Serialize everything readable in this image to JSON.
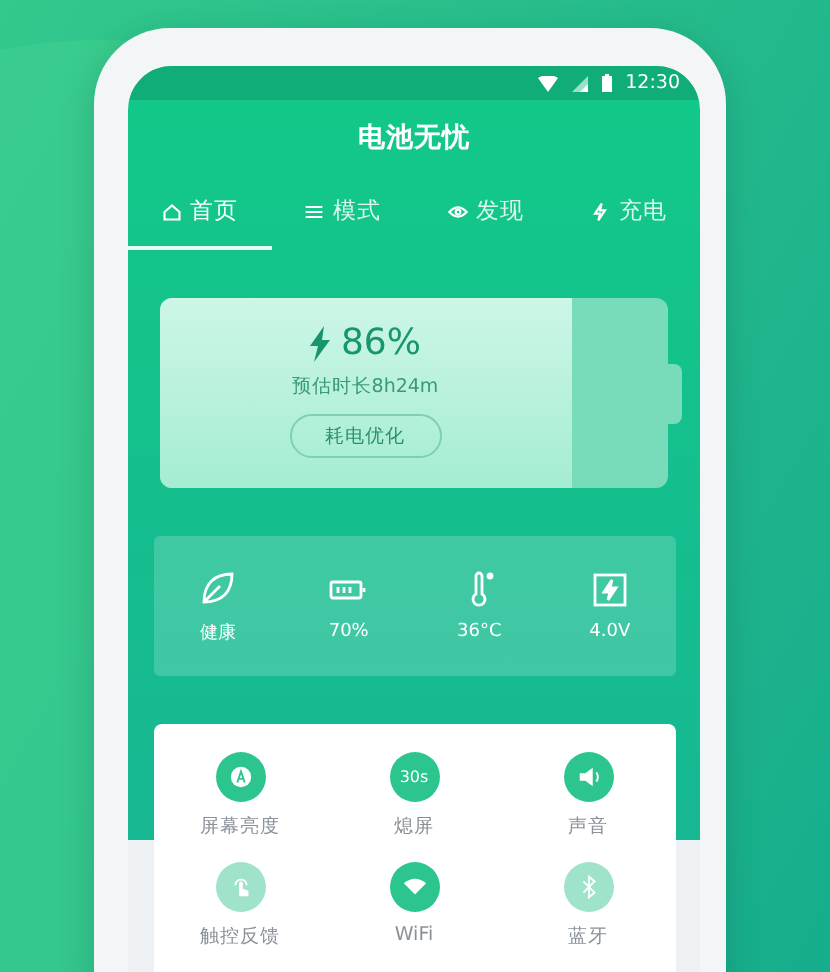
{
  "status_bar": {
    "time": "12:30"
  },
  "app": {
    "title": "电池无忧"
  },
  "tabs": [
    {
      "label": "首页",
      "kind": "home",
      "selected": true
    },
    {
      "label": "模式",
      "kind": "sliders",
      "selected": false
    },
    {
      "label": "发现",
      "kind": "eye",
      "selected": false
    },
    {
      "label": "充电",
      "kind": "bolt",
      "selected": false
    }
  ],
  "battery": {
    "percent": "86%",
    "estimate": "预估时长8h24m",
    "button": "耗电优化",
    "level": 0.81
  },
  "stats": [
    {
      "kind": "leaf",
      "label": "健康"
    },
    {
      "kind": "battery",
      "label": "70%"
    },
    {
      "kind": "thermometer",
      "label": "36°C"
    },
    {
      "kind": "voltage",
      "label": "4.0V"
    }
  ],
  "toggles": [
    {
      "kind": "brightness",
      "label": "屏幕亮度",
      "on": true
    },
    {
      "kind": "timer",
      "icon_text": "30s",
      "label": "熄屏",
      "on": true
    },
    {
      "kind": "sound",
      "label": "声音",
      "on": true
    },
    {
      "kind": "touch",
      "label": "触控反馈",
      "on": false
    },
    {
      "kind": "wifi",
      "label": "WiFi",
      "on": true
    },
    {
      "kind": "bluetooth",
      "label": "蓝牙",
      "on": false
    }
  ]
}
